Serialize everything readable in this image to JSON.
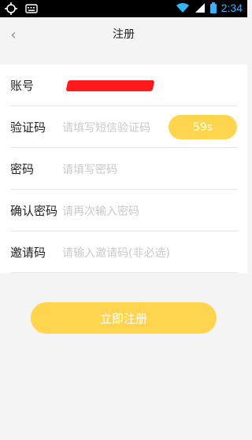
{
  "status_bar": {
    "time": "2:34",
    "icons": [
      "sync-icon",
      "keyboard-icon",
      "wifi-icon",
      "signal-icon",
      "battery-icon"
    ]
  },
  "header": {
    "title": "注册",
    "back_icon": "chevron-left-icon"
  },
  "form": {
    "account": {
      "label": "账号"
    },
    "verify_code": {
      "label": "验证码",
      "placeholder": "请填写短信验证码",
      "countdown": "59s"
    },
    "password": {
      "label": "密码",
      "placeholder": "请填写密码"
    },
    "confirm_password": {
      "label": "确认密码",
      "placeholder": "请再次输入密码"
    },
    "invite_code": {
      "label": "邀请码",
      "placeholder": "请输入邀请码(非必选)"
    }
  },
  "submit": {
    "label": "立即注册"
  },
  "colors": {
    "accent": "#ffd54f",
    "placeholder": "#c9c9c9",
    "background": "#f4f4f4",
    "time": "#2fb6ff",
    "redaction": "#ff1b1b"
  }
}
